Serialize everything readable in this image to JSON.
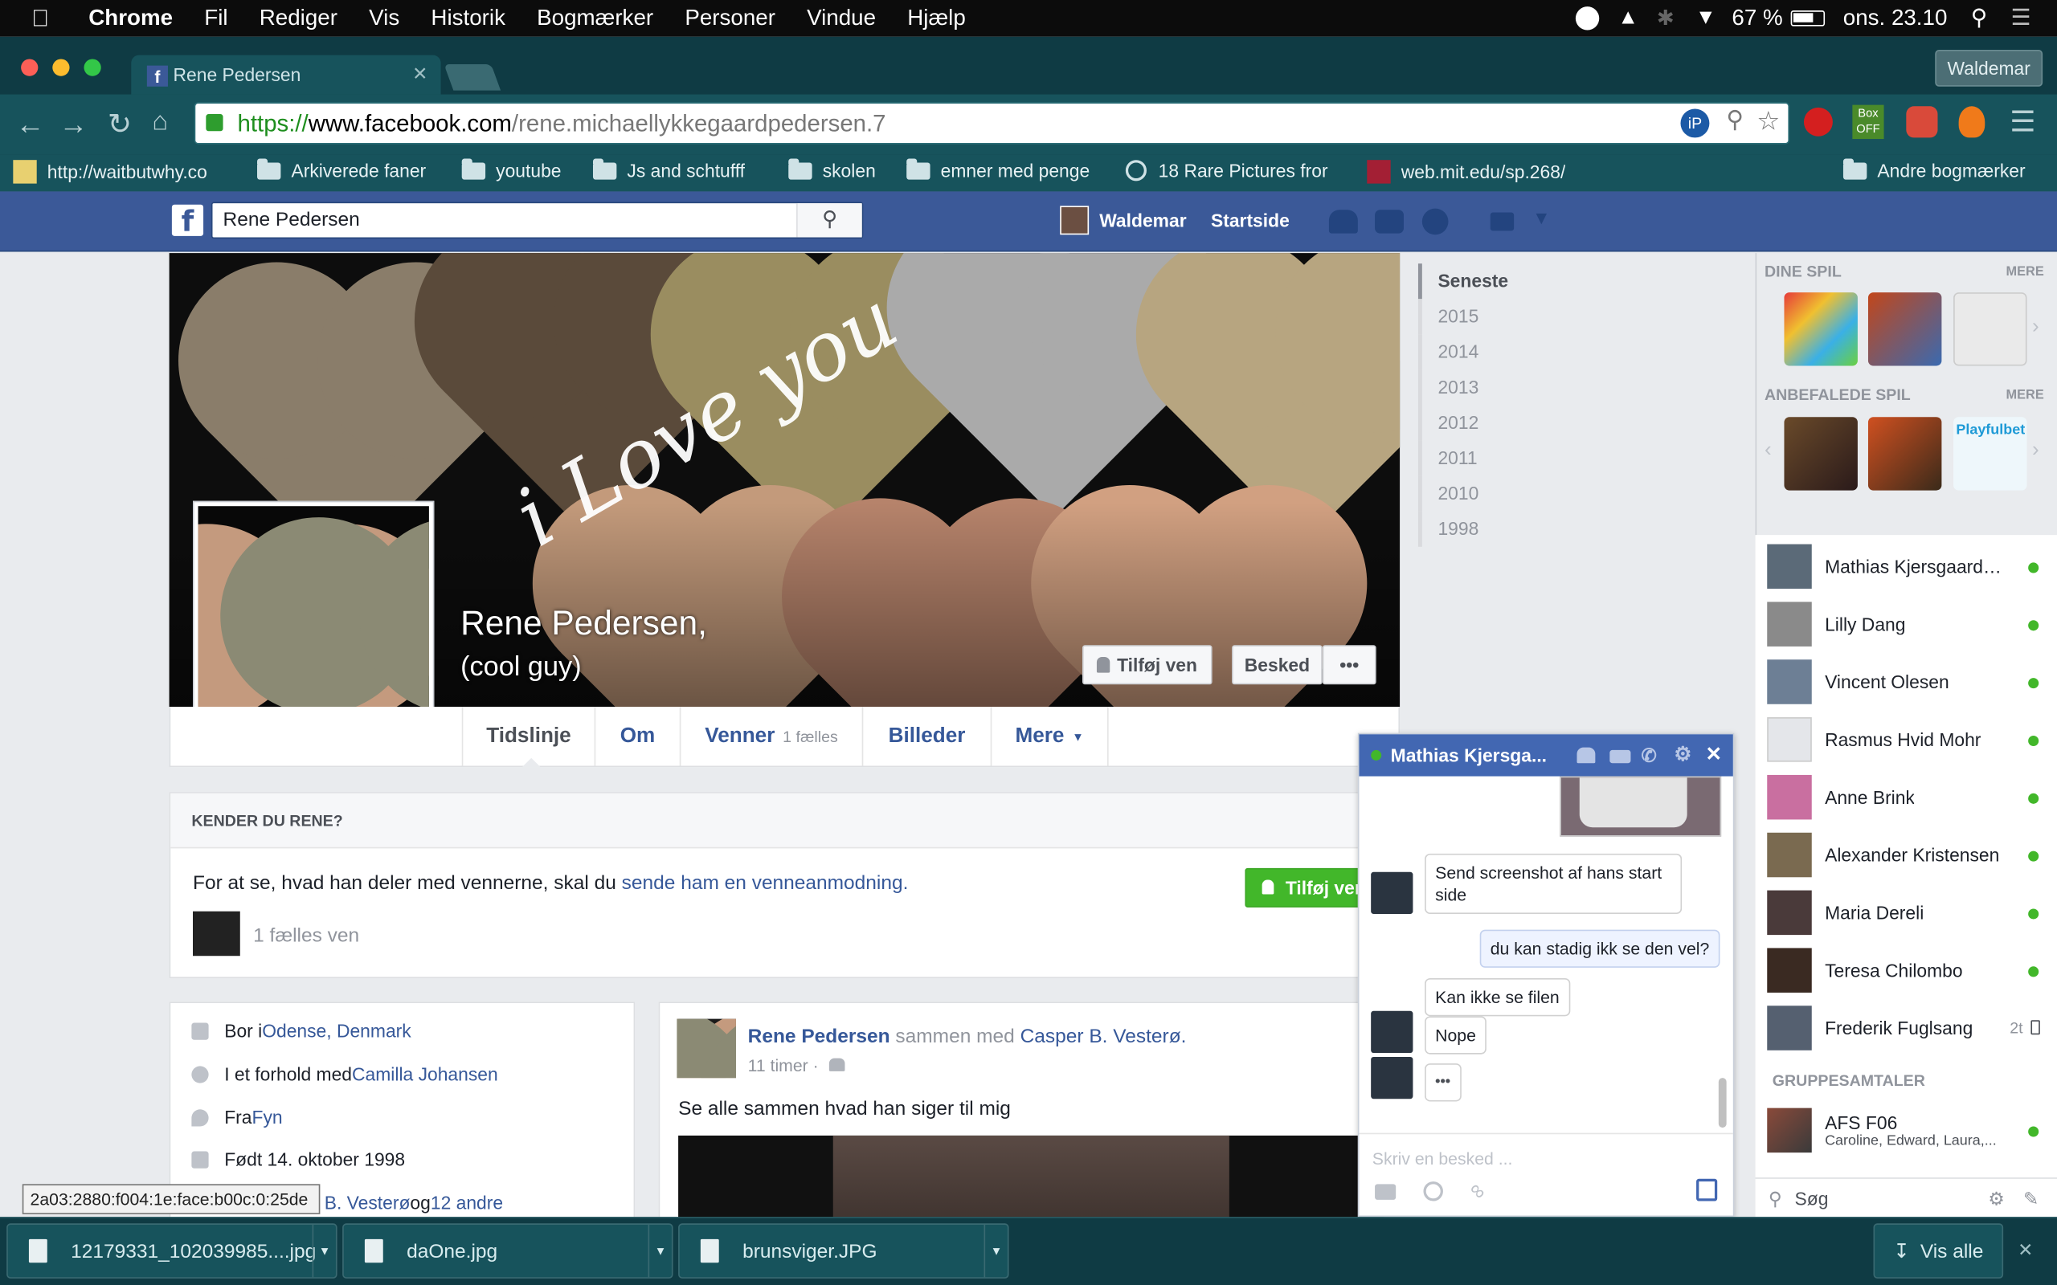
{
  "menubar": {
    "app": "Chrome",
    "items": [
      "Fil",
      "Rediger",
      "Vis",
      "Historik",
      "Bogmærker",
      "Personer",
      "Vindue",
      "Hjælp"
    ],
    "battery": "67 %",
    "datetime": "ons. 23.10"
  },
  "browser": {
    "tab_title": "Rene Pedersen",
    "profile_button": "Waldemar",
    "url_scheme": "https://",
    "url_host": "www.facebook.com",
    "url_path": "/rene.michaellykkegaardpedersen.7",
    "bookmarks": [
      "http://waitbutwhy.co",
      "Arkiverede faner",
      "youtube",
      "Js and schtufff",
      "skolen",
      "emner med penge",
      "18 Rare Pictures fror",
      "web.mit.edu/sp.268/",
      "Andre bogmærker"
    ]
  },
  "fb": {
    "search_value": "Rene Pedersen",
    "user_name": "Waldemar",
    "home": "Startside"
  },
  "profile": {
    "cover_text": "i Love you",
    "name": "Rene Pedersen,",
    "subtitle": "(cool guy)",
    "add_friend": "Tilføj ven",
    "message": "Besked",
    "more_dots": "•••",
    "tabs": {
      "timeline": "Tidslinje",
      "about": "Om",
      "friends": "Venner",
      "friends_count": "1 fælles",
      "photos": "Billeder",
      "more": "Mere"
    }
  },
  "years": [
    "Seneste",
    "2015",
    "2014",
    "2013",
    "2012",
    "2011",
    "2010",
    "1998"
  ],
  "kender": {
    "heading": "KENDER DU RENE?",
    "text_before": "For at se, hvad han deler med vennerne, skal du ",
    "link": "sende ham en venneanmodning.",
    "button": "Tilføj ven",
    "mutual": "1 fælles ven"
  },
  "intro": {
    "lives_pre": "Bor i ",
    "lives_link": "Odense, Denmark",
    "relation_pre": "I et forhold med ",
    "relation_link": "Camilla Johansen",
    "from_pre": "Fra ",
    "from_link": "Fyn",
    "born": "Født 14. oktober 1998",
    "with_pre": "med ",
    "with_link": "Casper B. Vesterø",
    "with_mid": " og ",
    "with_link2": "12 andre"
  },
  "post": {
    "author": "Rene Pedersen",
    "with_text": " sammen med ",
    "tagged": "Casper B. Vesterø.",
    "time": "11 timer ·",
    "text": "Se alle sammen hvad han siger til mig"
  },
  "sidebar": {
    "your_games": "DINE SPIL",
    "recommended": "ANBEFALEDE SPIL",
    "more": "MERE",
    "game_label": "Playfulbet",
    "friends": [
      {
        "name": "Mathias Kjersgaard ...",
        "color": "#5b6a78"
      },
      {
        "name": "Lilly Dang",
        "color": "#8a8a8a"
      },
      {
        "name": "Vincent Olesen",
        "color": "#6d7f95"
      },
      {
        "name": "Rasmus Hvid Mohr",
        "color": "#e4e6ea"
      },
      {
        "name": "Anne Brink",
        "color": "#c96fa0"
      },
      {
        "name": "Alexander Kristensen",
        "color": "#7a6a50"
      },
      {
        "name": "Maria Dereli",
        "color": "#4a3a3a"
      },
      {
        "name": "Teresa Chilombo",
        "color": "#3a2a22"
      },
      {
        "name": "Frederik Fuglsang",
        "color": "#556070"
      }
    ],
    "last_time": "2t",
    "group_heading": "GRUPPESAMTALER",
    "group_name": "AFS F06",
    "group_members": "Caroline, Edward, Laura,...",
    "search": "Søg"
  },
  "chat": {
    "title": "Mathias Kjersga...",
    "msg1": "Send screenshot af hans start side",
    "msg2": "du kan stadig ikk se den vel?",
    "msg3": "Kan ikke se filen",
    "msg4": "Nope",
    "typing": "•••",
    "placeholder": "Skriv en besked ..."
  },
  "tooltip": "2a03:2880:f004:1e:face:b00c:0:25de",
  "downloads": [
    "12179331_102039985....jpg",
    "daOne.jpg",
    "brunsviger.JPG"
  ],
  "show_all": "Vis alle",
  "colors": {
    "fb_blue": "#3b5998",
    "chrome_teal": "#17535c",
    "online_green": "#42b72a",
    "add_green": "#42b72a"
  }
}
